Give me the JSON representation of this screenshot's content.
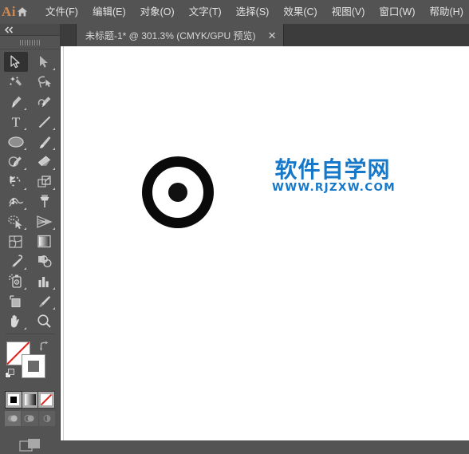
{
  "app": {
    "name": "Adobe Illustrator",
    "logo_text": "Ai",
    "logo_color": "#cf8a52",
    "home_icon": "home-icon"
  },
  "menubar": {
    "items": [
      {
        "label": "文件(F)",
        "name": "menu-file"
      },
      {
        "label": "编辑(E)",
        "name": "menu-edit"
      },
      {
        "label": "对象(O)",
        "name": "menu-object"
      },
      {
        "label": "文字(T)",
        "name": "menu-type"
      },
      {
        "label": "选择(S)",
        "name": "menu-select"
      },
      {
        "label": "效果(C)",
        "name": "menu-effect"
      },
      {
        "label": "视图(V)",
        "name": "menu-view"
      },
      {
        "label": "窗口(W)",
        "name": "menu-window"
      },
      {
        "label": "帮助(H)",
        "name": "menu-help"
      }
    ]
  },
  "document_tab": {
    "title": "未标题-1* @ 301.3% (CMYK/GPU 预览)",
    "document_name": "未标题-1",
    "modified": true,
    "zoom": "301.3%",
    "color_mode": "CMYK",
    "render_mode": "GPU 预览",
    "close_label": "✕"
  },
  "toolbar": {
    "collapse_label": "◀◀",
    "tools": [
      {
        "name": "selection-tool",
        "icon": "arrow-solid-icon",
        "active": true,
        "has_flyout": false
      },
      {
        "name": "direct-selection-tool",
        "icon": "arrow-white-icon",
        "active": false,
        "has_flyout": true
      },
      {
        "name": "magic-wand-tool",
        "icon": "magic-wand-icon",
        "active": false,
        "has_flyout": false
      },
      {
        "name": "lasso-tool",
        "icon": "lasso-icon",
        "active": false,
        "has_flyout": false
      },
      {
        "name": "pen-tool",
        "icon": "pen-icon",
        "active": false,
        "has_flyout": true
      },
      {
        "name": "curvature-tool",
        "icon": "curvature-icon",
        "active": false,
        "has_flyout": false
      },
      {
        "name": "type-tool",
        "icon": "type-icon",
        "active": false,
        "has_flyout": true
      },
      {
        "name": "line-segment-tool",
        "icon": "line-icon",
        "active": false,
        "has_flyout": true
      },
      {
        "name": "ellipse-tool",
        "icon": "ellipse-icon",
        "active": false,
        "has_flyout": true
      },
      {
        "name": "paintbrush-tool",
        "icon": "paintbrush-icon",
        "active": false,
        "has_flyout": true
      },
      {
        "name": "shaper-tool",
        "icon": "shaper-pencil-icon",
        "active": false,
        "has_flyout": true
      },
      {
        "name": "eraser-tool",
        "icon": "eraser-icon",
        "active": false,
        "has_flyout": true
      },
      {
        "name": "rotate-tool",
        "icon": "rotate-icon",
        "active": false,
        "has_flyout": true
      },
      {
        "name": "scale-tool",
        "icon": "scale-icon",
        "active": false,
        "has_flyout": true
      },
      {
        "name": "width-tool",
        "icon": "width-icon",
        "active": false,
        "has_flyout": true
      },
      {
        "name": "free-transform-tool",
        "icon": "pushpin-icon",
        "active": false,
        "has_flyout": false
      },
      {
        "name": "shape-builder-tool",
        "icon": "shape-builder-icon",
        "active": false,
        "has_flyout": true
      },
      {
        "name": "perspective-grid-tool",
        "icon": "perspective-grid-icon",
        "active": false,
        "has_flyout": true
      },
      {
        "name": "mesh-tool",
        "icon": "mesh-icon",
        "active": false,
        "has_flyout": false
      },
      {
        "name": "gradient-tool",
        "icon": "gradient-icon",
        "active": false,
        "has_flyout": false
      },
      {
        "name": "eyedropper-tool",
        "icon": "eyedropper-icon",
        "active": false,
        "has_flyout": true
      },
      {
        "name": "blend-tool",
        "icon": "blend-icon",
        "active": false,
        "has_flyout": false
      },
      {
        "name": "symbol-sprayer-tool",
        "icon": "symbol-sprayer-icon",
        "active": false,
        "has_flyout": true
      },
      {
        "name": "column-graph-tool",
        "icon": "column-graph-icon",
        "active": false,
        "has_flyout": true
      },
      {
        "name": "artboard-tool",
        "icon": "artboard-icon",
        "active": false,
        "has_flyout": false
      },
      {
        "name": "slice-tool",
        "icon": "slice-knife-icon",
        "active": false,
        "has_flyout": true
      },
      {
        "name": "hand-tool",
        "icon": "hand-icon",
        "active": false,
        "has_flyout": true
      },
      {
        "name": "zoom-tool",
        "icon": "magnifier-icon",
        "active": false,
        "has_flyout": false
      }
    ],
    "color_controls": {
      "fill": {
        "name": "fill-swatch",
        "value": "none",
        "color": "#ffffff"
      },
      "stroke": {
        "name": "stroke-swatch",
        "value": "gray",
        "color": "#6b6b6b"
      },
      "swap": {
        "name": "swap-fill-stroke-icon"
      },
      "defaults": {
        "name": "default-fill-stroke-icon"
      },
      "modes": [
        {
          "name": "color-mode-button",
          "icon": "solid-color-icon",
          "selected": true
        },
        {
          "name": "gradient-mode-button",
          "icon": "gradient-icon",
          "selected": false
        },
        {
          "name": "none-mode-button",
          "icon": "none-slash-icon",
          "selected": false
        }
      ],
      "draw_modes": [
        {
          "name": "draw-normal-button",
          "icon": "draw-normal-icon",
          "selected": true
        },
        {
          "name": "draw-behind-button",
          "icon": "draw-behind-icon",
          "selected": false
        },
        {
          "name": "draw-inside-button",
          "icon": "draw-inside-icon",
          "selected": false
        }
      ],
      "screen_mode": {
        "name": "change-screen-mode-button",
        "icon": "screen-mode-icon"
      }
    }
  },
  "canvas": {
    "background": "#ffffff",
    "artwork": {
      "name": "ring-with-center-dot",
      "shapes": [
        {
          "name": "outer-ring",
          "type": "circle-stroke",
          "color": "#0a0a0a"
        },
        {
          "name": "center-dot",
          "type": "circle-fill",
          "color": "#111111"
        }
      ]
    },
    "watermark": {
      "chinese": "软件自学网",
      "url": "WWW.RJZXW.COM",
      "color": "#1578c8"
    }
  }
}
